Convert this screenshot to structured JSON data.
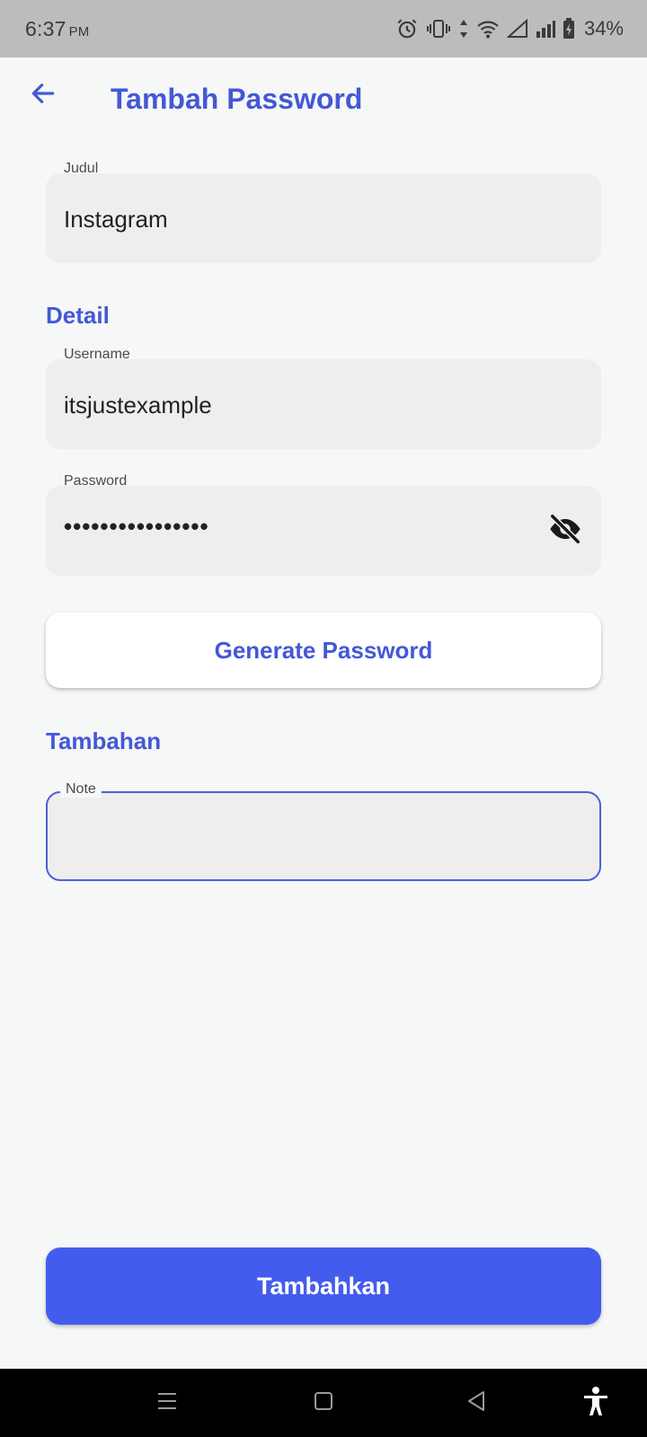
{
  "status_bar": {
    "time": "6:37",
    "ampm": "PM",
    "battery": "34%",
    "icons": [
      "alarm-icon",
      "vibrate-icon",
      "data-arrows-icon",
      "wifi-icon",
      "signal-empty-icon",
      "signal-icon",
      "battery-charging-icon"
    ]
  },
  "header": {
    "back_icon": "arrow-left-icon",
    "title": "Tambah Password"
  },
  "form": {
    "title_field": {
      "label": "Judul",
      "value": "Instagram"
    },
    "detail_heading": "Detail",
    "username_field": {
      "label": "Username",
      "value": "itsjustexample"
    },
    "password_field": {
      "label": "Password",
      "value": "••••••••••••••••",
      "toggle_icon": "eye-off-icon"
    },
    "generate_label": "Generate Password",
    "extra_heading": "Tambahan",
    "note_field": {
      "label": "Note",
      "value": ""
    },
    "submit_label": "Tambahkan"
  },
  "colors": {
    "accent": "#4458d6",
    "primary_button": "#435ced",
    "field_bg": "#eeeeee",
    "page_bg": "#f6f7f7",
    "status_bar_bg": "#bbbcbb",
    "nav_bar_bg": "#000000"
  },
  "nav_bar": {
    "icons": [
      "recents-icon",
      "home-icon",
      "back-triangle-icon",
      "accessibility-icon"
    ]
  }
}
